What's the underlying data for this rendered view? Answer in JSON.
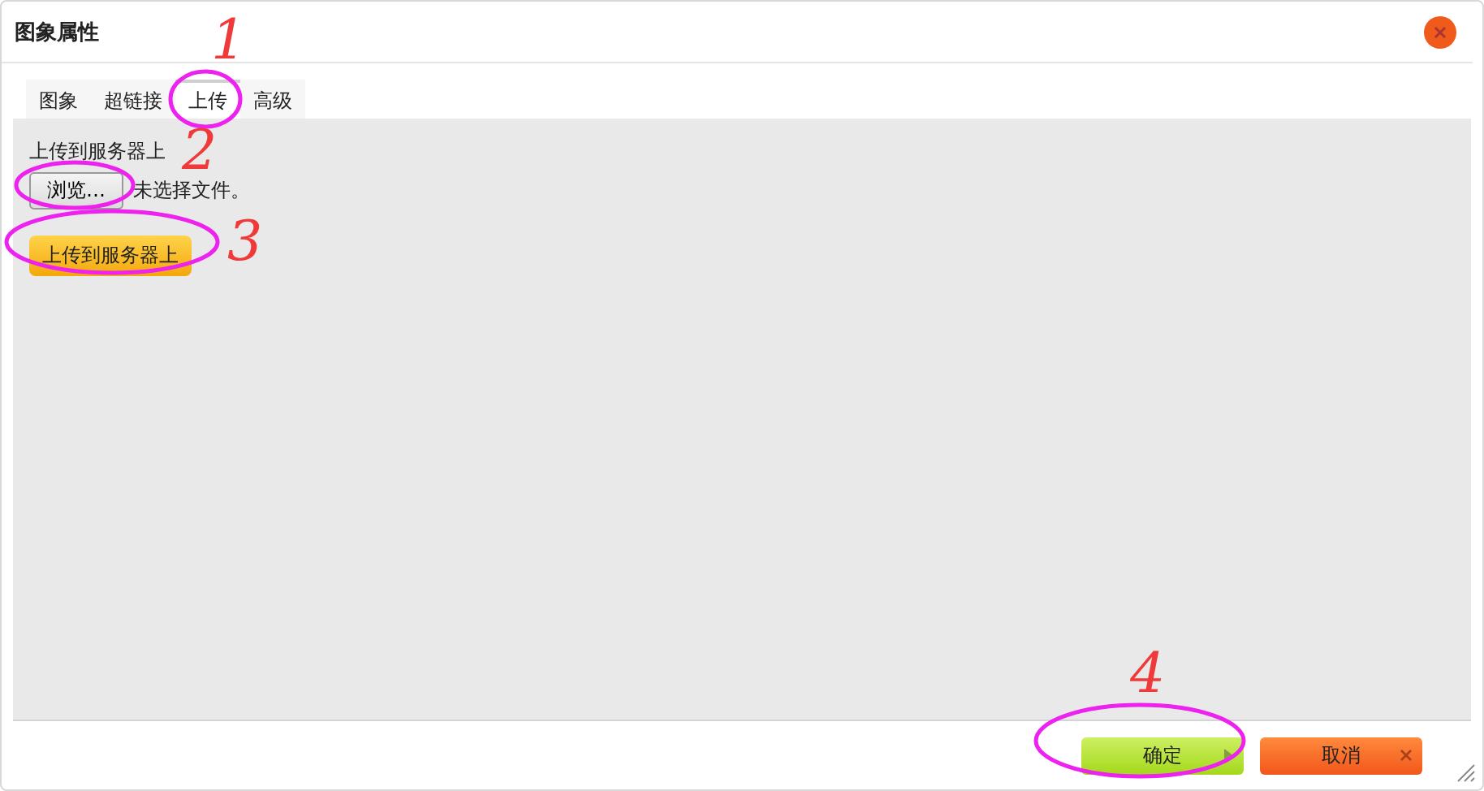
{
  "window": {
    "title": "图象属性"
  },
  "tabs": [
    {
      "label": "图象",
      "selected": false
    },
    {
      "label": "超链接",
      "selected": false
    },
    {
      "label": "上传",
      "selected": true
    },
    {
      "label": "高级",
      "selected": false
    }
  ],
  "upload": {
    "label": "上传到服务器上",
    "browse_button": "浏览…",
    "file_status": "未选择文件。",
    "send_button": "上传到服务器上"
  },
  "buttons": [
    {
      "label": "确定",
      "kind": "ok"
    },
    {
      "label": "取消",
      "kind": "cancel"
    }
  ],
  "annotations": [
    {
      "label": "1"
    },
    {
      "label": "2"
    },
    {
      "label": "3"
    },
    {
      "label": "4"
    }
  ]
}
